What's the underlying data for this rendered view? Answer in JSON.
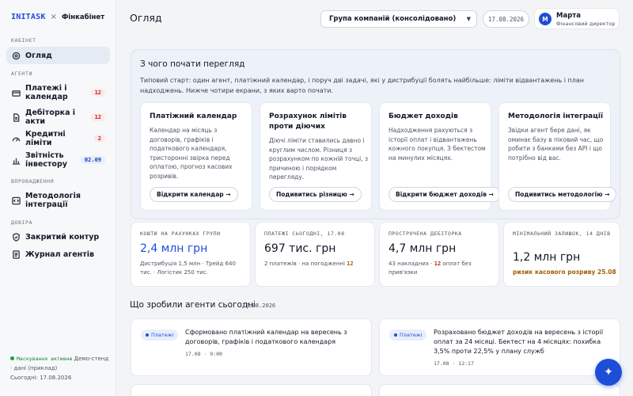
{
  "brand": {
    "name": "INITASK",
    "separator": "×",
    "product": "Фінкабінет"
  },
  "sidebar": {
    "sections": [
      {
        "label": "КАБІНЕТ"
      },
      {
        "label": "АГЕНТИ"
      },
      {
        "label": "ВПРОВАДЖЕННЯ"
      },
      {
        "label": "ДОВІРА"
      }
    ],
    "items": [
      {
        "label": "Огляд",
        "icon": "target-icon",
        "active": true
      },
      {
        "label": "Платежі і календар",
        "icon": "card-icon",
        "badge": "12"
      },
      {
        "label": "Дебіторка і акти",
        "icon": "document-icon",
        "badge": "12"
      },
      {
        "label": "Кредитні ліміти",
        "icon": "gauge-icon",
        "badge": "2"
      },
      {
        "label": "Звітність інвестору",
        "icon": "bar-chart-icon",
        "badge": "02.09"
      },
      {
        "label": "Методологія інтеграції",
        "icon": "code-icon"
      },
      {
        "label": "Закритий контур",
        "icon": "shield-icon"
      },
      {
        "label": "Журнал агентів",
        "icon": "journal-icon"
      }
    ],
    "footer": {
      "status": "Маскування активне",
      "text": " Демо-стенд · дані (приклад)",
      "date_text": "Сьогодні: 17.08.2026"
    }
  },
  "header": {
    "title": "Огляд",
    "company_select": "Група компаній (консолідовано)",
    "date": "17.08.2026",
    "user": {
      "initial": "М",
      "name": "Марта",
      "role": "Фінансовий директор"
    }
  },
  "start": {
    "title": "З чого почати перегляд",
    "description": "Типовий старт: один агент, платіжний календар, і поруч дві задачі, які у дистрибуції болять найбільше: ліміти відвантажень і план надходжень. Нижче чотири екрани, з яких варто почати.",
    "cards": [
      {
        "title": "Платіжний календар",
        "text": "Календар на місяць з договорів, графіків і податкового календаря, тристоронні звірка перед оплатою, прогноз касових розривів.",
        "button": "Відкрити календар →"
      },
      {
        "title": "Розрахунок лімітів проти діючих",
        "text": "Діючі ліміти ставились давно і круглим числом. Різниця з розрахунком по кожній точці, з причиною і порядком перегляду.",
        "button": "Подивитись різницю →"
      },
      {
        "title": "Бюджет доходів",
        "text": "Надходження рахуються з історії оплат і відвантажень кожного покупця. З бектестом на минулих місяцях.",
        "button": "Відкрити бюджет доходів →"
      },
      {
        "title": "Методологія інтеграції",
        "text": "Звідки агент бере дані, як оминає базу в піковий час, що робити з банками без API і що потрібно від вас.",
        "button": "Подивитись методологію →"
      }
    ]
  },
  "kpis": [
    {
      "label": "КОШТИ НА РАХУНКАХ ГРУПИ",
      "value": "2,4 млн грн",
      "sub": "Дистрибуція 1,5 млн · Трейд 640 тис. · Логістик 250 тис."
    },
    {
      "label": "ПЛАТЕЖІ СЬОГОДНІ, 17.08",
      "value": "697 тис. грн",
      "sub_prefix": "2 платежів · на погодженні ",
      "sub_highlight": "12"
    },
    {
      "label": "ПРОСТРОЧЕНА ДЕБІТОРКА",
      "value": "4,7 млн грн",
      "sub_prefix": "43 накладних · ",
      "sub_highlight": "12",
      "sub_suffix": " оплат без прив'язки"
    },
    {
      "label": "МІНІМАЛЬНИЙ ЗАЛИШОК, 14 ДНІВ",
      "value": "1,2 млн грн",
      "warning": "ризик касового розриву 25.08"
    }
  ],
  "activity": {
    "title": "Що зробили агенти сьогодні",
    "date": "17.08.2026",
    "items": [
      {
        "tag": "Платежі",
        "text": "Сформовано платіжний календар на вересень з договорів, графіків і податкового календаря",
        "time": "17.08 · 9:00"
      },
      {
        "tag": "Платежі",
        "text": "Розраховано бюджет доходів на вересень з історії оплат за 24 місяці. Бектест на 4 місяцях: похибка 3,5% проти 22,5% у плану служб",
        "time": "17.08 · 12:17"
      }
    ]
  },
  "fab_icon": "sparkle-icon",
  "colors": {
    "accent": "#1d4ed8",
    "danger": "#b91c1c",
    "warning": "#a16207",
    "success": "#16a34a"
  }
}
